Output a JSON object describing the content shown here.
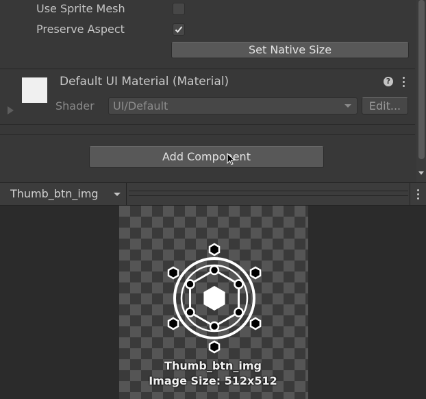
{
  "image_component": {
    "use_sprite_mesh_label": "Use Sprite Mesh",
    "use_sprite_mesh_checked": false,
    "preserve_aspect_label": "Preserve Aspect",
    "preserve_aspect_checked": true,
    "set_native_size_label": "Set Native Size"
  },
  "material": {
    "title": "Default UI Material (Material)",
    "shader_label": "Shader",
    "shader_value": "UI/Default",
    "edit_label": "Edit...",
    "help_icon": "help-icon",
    "menu_icon": "kebab-menu-icon"
  },
  "add_component_label": "Add Component",
  "preview": {
    "title": "Thumb_btn_img",
    "caption_name": "Thumb_btn_img",
    "caption_size": "Image Size: 512x512"
  }
}
